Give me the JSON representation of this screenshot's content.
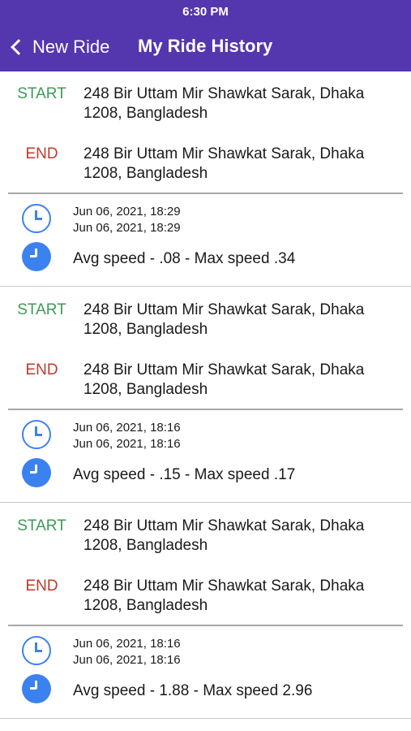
{
  "status_bar": {
    "time": "6:30 PM"
  },
  "nav": {
    "back_label": "New Ride",
    "title": "My Ride History"
  },
  "colors": {
    "header": "#5436ae",
    "start": "#3f9a5a",
    "end": "#c0392b",
    "icon": "#3b82f0"
  },
  "labels": {
    "start": "START",
    "end": "END"
  },
  "icons": {
    "start_time": "clock-outline-icon",
    "speed": "clock-filled-icon",
    "back": "chevron-left-icon"
  },
  "rides": [
    {
      "start_address": "248 Bir Uttam Mir Shawkat Sarak, Dhaka 1208, Bangladesh",
      "end_address": "248 Bir Uttam Mir Shawkat Sarak, Dhaka 1208, Bangladesh",
      "start_time": "Jun 06, 2021, 18:29",
      "end_time": "Jun 06, 2021, 18:29",
      "speed": "Avg speed - .08 - Max speed .34"
    },
    {
      "start_address": "248 Bir Uttam Mir Shawkat Sarak, Dhaka 1208, Bangladesh",
      "end_address": "248 Bir Uttam Mir Shawkat Sarak, Dhaka 1208, Bangladesh",
      "start_time": "Jun 06, 2021, 18:16",
      "end_time": "Jun 06, 2021, 18:16",
      "speed": "Avg speed - .15 - Max speed .17"
    },
    {
      "start_address": "248 Bir Uttam Mir Shawkat Sarak, Dhaka 1208, Bangladesh",
      "end_address": "248 Bir Uttam Mir Shawkat Sarak, Dhaka 1208, Bangladesh",
      "start_time": "Jun 06, 2021, 18:16",
      "end_time": "Jun 06, 2021, 18:16",
      "speed": "Avg speed - 1.88 - Max speed 2.96"
    }
  ]
}
